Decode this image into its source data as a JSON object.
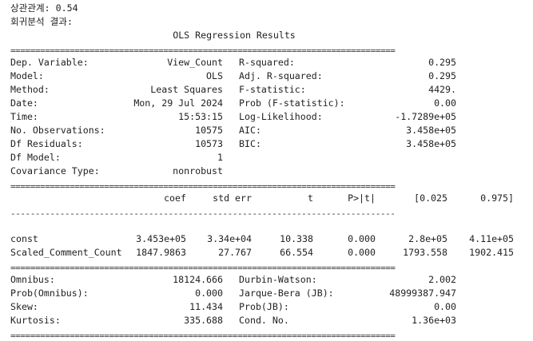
{
  "console": {
    "corr_label": "상관관계: ",
    "corr_value": "0.54",
    "regression_label": "회귀분석 결과:"
  },
  "ols": {
    "title": "OLS Regression Results",
    "summary_left": [
      {
        "label": "Dep. Variable:",
        "value": "View_Count"
      },
      {
        "label": "Model:",
        "value": "OLS"
      },
      {
        "label": "Method:",
        "value": "Least Squares"
      },
      {
        "label": "Date:",
        "value": "Mon, 29 Jul 2024"
      },
      {
        "label": "Time:",
        "value": "15:53:15"
      },
      {
        "label": "No. Observations:",
        "value": "10575"
      },
      {
        "label": "Df Residuals:",
        "value": "10573"
      },
      {
        "label": "Df Model:",
        "value": "1"
      },
      {
        "label": "Covariance Type:",
        "value": "nonrobust"
      }
    ],
    "summary_right": [
      {
        "label": "R-squared:",
        "value": "0.295"
      },
      {
        "label": "Adj. R-squared:",
        "value": "0.295"
      },
      {
        "label": "F-statistic:",
        "value": "4429."
      },
      {
        "label": "Prob (F-statistic):",
        "value": "0.00"
      },
      {
        "label": "Log-Likelihood:",
        "value": "-1.7289e+05"
      },
      {
        "label": "AIC:",
        "value": "3.458e+05"
      },
      {
        "label": "BIC:",
        "value": "3.458e+05"
      }
    ],
    "coef_headers": [
      "coef",
      "std err",
      "t",
      "P>|t|",
      "[0.025",
      "0.975]"
    ],
    "coef_rows": [
      {
        "name": "const",
        "values": [
          "3.453e+05",
          "3.34e+04",
          "10.338",
          "0.000",
          "2.8e+05",
          "4.11e+05"
        ]
      },
      {
        "name": "Scaled_Comment_Count",
        "values": [
          "1847.9863",
          "27.767",
          "66.554",
          "0.000",
          "1793.558",
          "1902.415"
        ]
      }
    ],
    "diagnostics_left": [
      {
        "label": "Omnibus:",
        "value": "18124.666"
      },
      {
        "label": "Prob(Omnibus):",
        "value": "0.000"
      },
      {
        "label": "Skew:",
        "value": "11.434"
      },
      {
        "label": "Kurtosis:",
        "value": "335.688"
      }
    ],
    "diagnostics_right": [
      {
        "label": "Durbin-Watson:",
        "value": "2.002"
      },
      {
        "label": "Jarque-Bera (JB):",
        "value": "48999387.947"
      },
      {
        "label": "Prob(JB):",
        "value": "0.00"
      },
      {
        "label": "Cond. No.",
        "value": "1.36e+03"
      }
    ],
    "sep_double": "==============================================================================",
    "sep_single": "------------------------------------------------------------------------------"
  }
}
